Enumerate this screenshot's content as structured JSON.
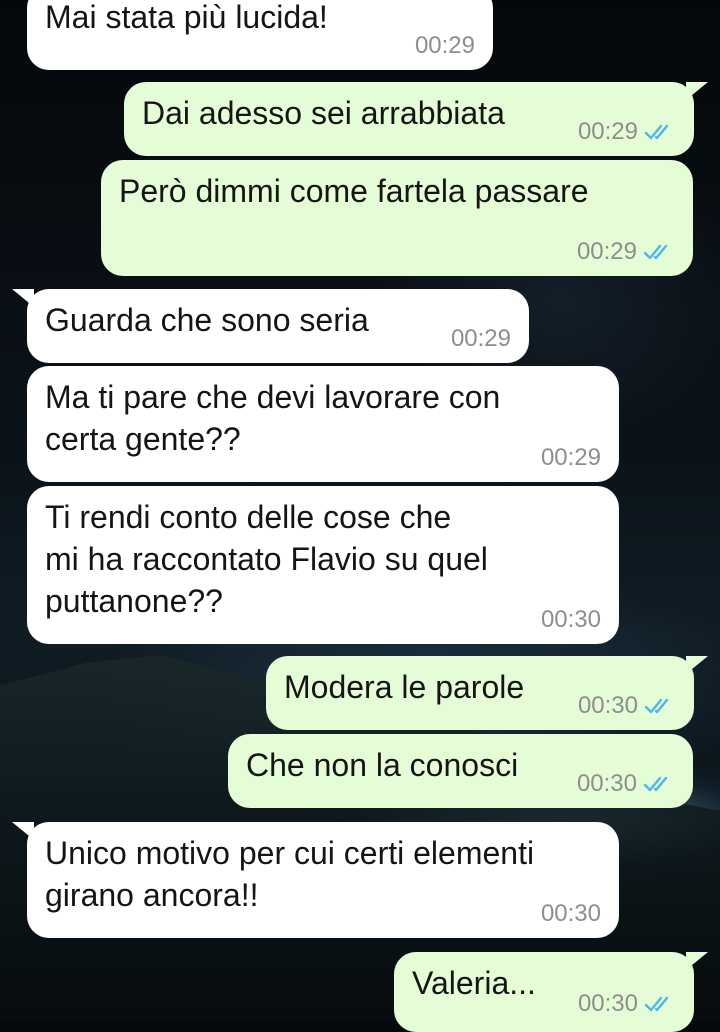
{
  "colors": {
    "incoming_bubble": "#ffffff",
    "outgoing_bubble": "#e5fdd6",
    "timestamp": "#8e8e8e",
    "read_ticks": "#4fb6ec"
  },
  "messages": [
    {
      "direction": "incoming",
      "text": "Mai stata più lucida!",
      "time": "00:29"
    },
    {
      "direction": "outgoing",
      "text": "Dai adesso sei arrabbiata",
      "time": "00:29",
      "status_icon": "double-check-read-icon"
    },
    {
      "direction": "outgoing",
      "text": "Però dimmi come fartela passare",
      "time": "00:29",
      "status_icon": "double-check-read-icon"
    },
    {
      "direction": "incoming",
      "text": "Guarda che sono seria",
      "time": "00:29"
    },
    {
      "direction": "incoming",
      "text": "Ma ti pare che devi lavorare con\ncerta gente??",
      "time": "00:29"
    },
    {
      "direction": "incoming",
      "text": "Ti rendi conto delle cose che\nmi ha raccontato Flavio su quel\nputtanone??",
      "time": "00:30"
    },
    {
      "direction": "outgoing",
      "text": "Modera le parole",
      "time": "00:30",
      "status_icon": "double-check-read-icon"
    },
    {
      "direction": "outgoing",
      "text": "Che non la conosci",
      "time": "00:30",
      "status_icon": "double-check-read-icon"
    },
    {
      "direction": "incoming",
      "text": "Unico motivo per cui certi elementi\ngirano ancora!!",
      "time": "00:30"
    },
    {
      "direction": "outgoing",
      "text": "Valeria...",
      "time": "00:30",
      "status_icon": "double-check-read-icon"
    }
  ]
}
